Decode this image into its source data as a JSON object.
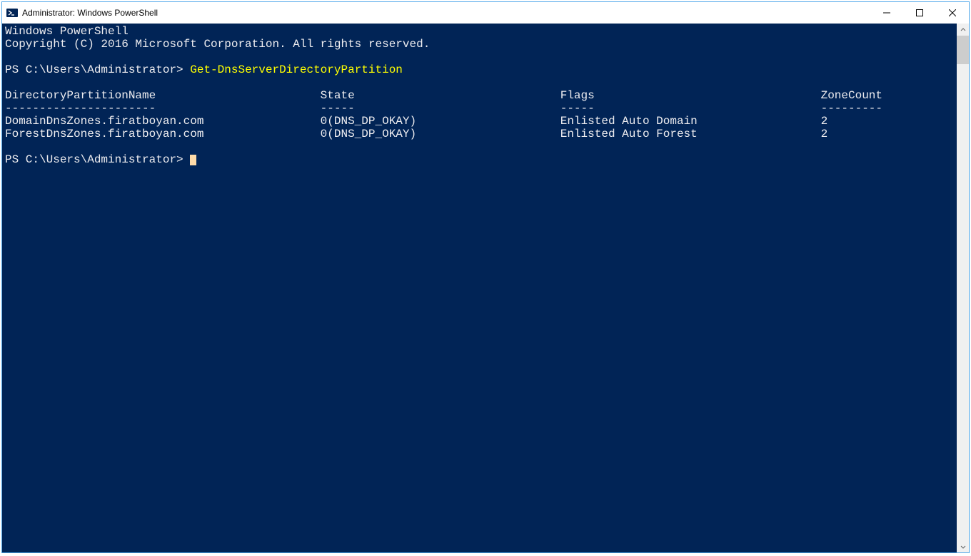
{
  "window": {
    "title": "Administrator: Windows PowerShell"
  },
  "terminal": {
    "banner_line1": "Windows PowerShell",
    "banner_line2": "Copyright (C) 2016 Microsoft Corporation. All rights reserved.",
    "prompt": "PS C:\\Users\\Administrator>",
    "command": "Get-DnsServerDirectoryPartition",
    "header_line": "DirectoryPartitionName                        State                              Flags                                 ZoneCount",
    "divider_line": "----------------------                        -----                              -----                                 ---------",
    "rows": [
      {
        "line": "DomainDnsZones.firatboyan.com                 0(DNS_DP_OKAY)                     Enlisted Auto Domain                  2",
        "name": "DomainDnsZones.firatboyan.com",
        "state": "0(DNS_DP_OKAY)",
        "flags": "Enlisted Auto Domain",
        "zone_count": "2"
      },
      {
        "line": "ForestDnsZones.firatboyan.com                 0(DNS_DP_OKAY)                     Enlisted Auto Forest                  2",
        "name": "ForestDnsZones.firatboyan.com",
        "state": "0(DNS_DP_OKAY)",
        "flags": "Enlisted Auto Forest",
        "zone_count": "2"
      }
    ]
  }
}
